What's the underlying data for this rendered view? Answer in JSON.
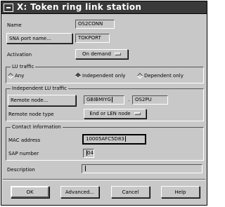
{
  "window": {
    "title": "X: Token ring link station"
  },
  "name": {
    "label": "Name",
    "value": "OS2CONN"
  },
  "sna_port": {
    "button": "SNA port name...",
    "value": "TOKPORT"
  },
  "activation": {
    "label": "Activation",
    "selected": "On demand"
  },
  "lu_traffic": {
    "title": "LU traffic",
    "options": [
      "Any",
      "Independent only",
      "Dependent only"
    ],
    "selected": "Independent only"
  },
  "independent": {
    "title": "Independent LU traffic",
    "remote_node_button": "Remote node...",
    "remote_node_net": "GBIBMIYG",
    "separator": ".",
    "remote_node_name": "OS2PU",
    "remote_node_type_label": "Remote node type",
    "remote_node_type_selected": "End or LEN node"
  },
  "contact": {
    "title": "Contact information",
    "mac_label": "MAC address",
    "mac_value": "10005AFC5D83",
    "sap_label": "SAP number",
    "sap_value": "04"
  },
  "description": {
    "label": "Description",
    "value": ""
  },
  "buttons": {
    "ok": "OK",
    "advanced": "Advanced...",
    "cancel": "Cancel",
    "help": "Help"
  }
}
